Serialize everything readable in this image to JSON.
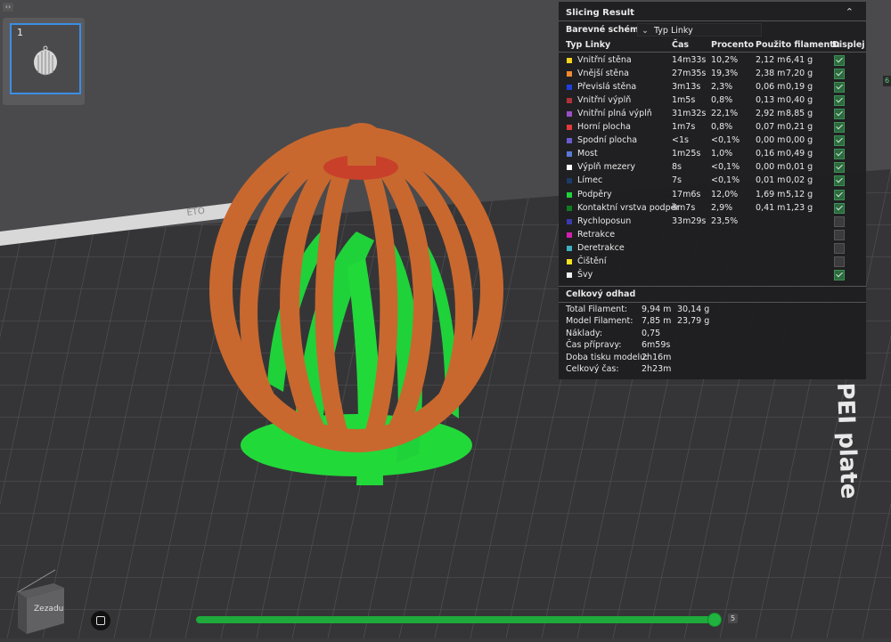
{
  "panel": {
    "title": "Slicing Result",
    "collapse_icon": "chevron-up-icon",
    "scheme_label": "Barevné schéma",
    "scheme_value": "Typ Linky",
    "headers": {
      "type": "Typ Linky",
      "time": "Čas",
      "percent": "Procento",
      "filament": "Použito filamentu",
      "display": "Displej"
    },
    "rows": [
      {
        "name": "Vnitřní stěna",
        "color": "#f5d21f",
        "time": "14m33s",
        "percent": "10,2%",
        "len": "2,12 m",
        "weight": "6,41 g",
        "checked": true
      },
      {
        "name": "Vnější stěna",
        "color": "#f28a2e",
        "time": "27m35s",
        "percent": "19,3%",
        "len": "2,38 m",
        "weight": "7,20 g",
        "checked": true
      },
      {
        "name": "Převislá stěna",
        "color": "#1f3fe0",
        "time": "3m13s",
        "percent": "2,3%",
        "len": "0,06 m",
        "weight": "0,19 g",
        "checked": true
      },
      {
        "name": "Vnitřní výplň",
        "color": "#b0313a",
        "time": "1m5s",
        "percent": "0,8%",
        "len": "0,13 m",
        "weight": "0,40 g",
        "checked": true
      },
      {
        "name": "Vnitřní plná výplň",
        "color": "#9a4fc4",
        "time": "31m32s",
        "percent": "22,1%",
        "len": "2,92 m",
        "weight": "8,85 g",
        "checked": true
      },
      {
        "name": "Horní plocha",
        "color": "#e23a3a",
        "time": "1m7s",
        "percent": "0,8%",
        "len": "0,07 m",
        "weight": "0,21 g",
        "checked": true
      },
      {
        "name": "Spodní plocha",
        "color": "#6b5bd1",
        "time": "<1s",
        "percent": "<0,1%",
        "len": "0,00 m",
        "weight": "0,00 g",
        "checked": true
      },
      {
        "name": "Most",
        "color": "#5a7ad6",
        "time": "1m25s",
        "percent": "1,0%",
        "len": "0,16 m",
        "weight": "0,49 g",
        "checked": true
      },
      {
        "name": "Výplň mezery",
        "color": "#ffffff",
        "time": "8s",
        "percent": "<0,1%",
        "len": "0,00 m",
        "weight": "0,01 g",
        "checked": true
      },
      {
        "name": "Límec",
        "color": "#1a3a6a",
        "time": "7s",
        "percent": "<0,1%",
        "len": "0,01 m",
        "weight": "0,02 g",
        "checked": true
      },
      {
        "name": "Podpěry",
        "color": "#1fd23a",
        "time": "17m6s",
        "percent": "12,0%",
        "len": "1,69 m",
        "weight": "5,12 g",
        "checked": true
      },
      {
        "name": "Kontaktní vrstva podpěr",
        "color": "#0f7a1f",
        "time": "4m7s",
        "percent": "2,9%",
        "len": "0,41 m",
        "weight": "1,23 g",
        "checked": true
      },
      {
        "name": "Rychloposun",
        "color": "#3a3ab0",
        "time": "33m29s",
        "percent": "23,5%",
        "len": "",
        "weight": "",
        "checked": false
      },
      {
        "name": "Retrakce",
        "color": "#d21fb0",
        "time": "",
        "percent": "",
        "len": "",
        "weight": "",
        "checked": false
      },
      {
        "name": "Deretrakce",
        "color": "#3fb0c0",
        "time": "",
        "percent": "",
        "len": "",
        "weight": "",
        "checked": false
      },
      {
        "name": "Čištění",
        "color": "#f5e21f",
        "time": "",
        "percent": "",
        "len": "",
        "weight": "",
        "checked": false
      },
      {
        "name": "Švy",
        "color": "#f0f0f0",
        "time": "",
        "percent": "",
        "len": "",
        "weight": "",
        "checked": true
      }
    ],
    "estimate_title": "Celkový odhad",
    "estimates": [
      {
        "label": "Total Filament:",
        "v1": "9,94 m",
        "v2": "30,14 g"
      },
      {
        "label": "Model Filament:",
        "v1": "7,85 m",
        "v2": "23,79 g"
      },
      {
        "label": "Náklady:",
        "v1": "0,75",
        "v2": ""
      },
      {
        "label": "Čas přípravy:",
        "v1": "6m59s",
        "v2": ""
      },
      {
        "label": "Doba tisku modelu:",
        "v1": "2h16m",
        "v2": ""
      },
      {
        "label": "Celkový čas:",
        "v1": "2h23m",
        "v2": ""
      }
    ]
  },
  "plate": {
    "thumb_number": "1",
    "label_text": "PEI plate",
    "front_text": "ETO"
  },
  "view_label": "Zezadu",
  "layer_slider": {
    "value_fraction": 1.0,
    "label": "5"
  },
  "colors": {
    "outer_wall": "#c8682f",
    "support": "#22d93a",
    "top": "#c8402a",
    "bed": "#3d3d3f"
  }
}
